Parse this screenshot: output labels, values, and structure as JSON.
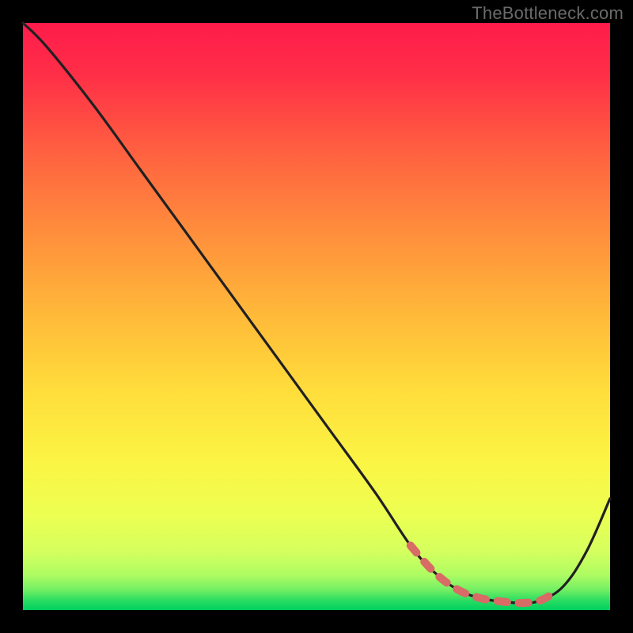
{
  "watermark": "TheBottleneck.com",
  "colors": {
    "top": "#ff1b4b",
    "mid_upper": "#ff7a3d",
    "mid": "#ffd23a",
    "mid_lower": "#f3f94a",
    "lower": "#d9ff66",
    "bottom": "#00d463",
    "curve_stroke": "#212022",
    "dash_stroke": "#d86b66",
    "bg": "#000000"
  },
  "chart_data": {
    "type": "line",
    "title": "",
    "xlabel": "",
    "ylabel": "",
    "xlim": [
      0,
      100
    ],
    "ylim": [
      0,
      100
    ],
    "series": [
      {
        "name": "bottleneck-curve",
        "x": [
          0,
          4,
          12,
          20,
          28,
          36,
          44,
          52,
          60,
          66,
          70,
          74,
          78,
          82,
          85,
          88,
          92,
          96,
          100
        ],
        "y": [
          100,
          96,
          86,
          75,
          64,
          53,
          42,
          31,
          20,
          11,
          6.5,
          3.5,
          2,
          1.4,
          1.2,
          1.6,
          4,
          10,
          19
        ]
      }
    ],
    "dashed_segment": {
      "x": [
        66,
        70,
        74,
        78,
        82,
        85,
        88,
        90
      ],
      "y": [
        11,
        6.5,
        3.5,
        2,
        1.4,
        1.2,
        1.6,
        2.6
      ]
    }
  }
}
